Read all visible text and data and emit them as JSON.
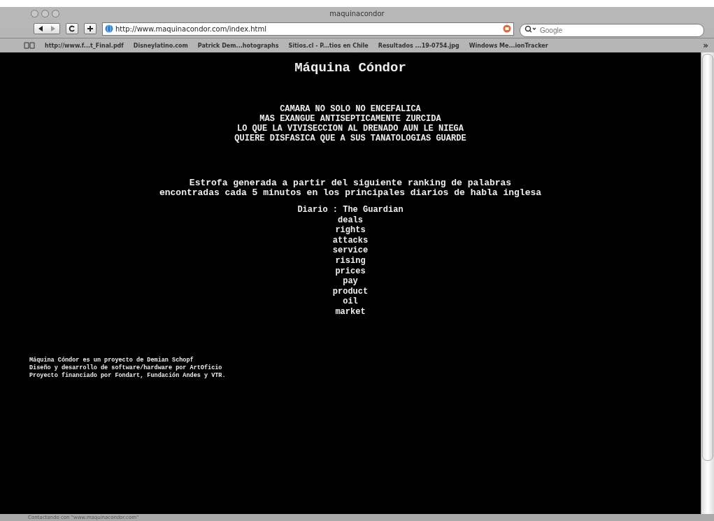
{
  "window": {
    "title": "maquinacondor"
  },
  "toolbar": {
    "url": "http://www.maquinacondor.com/index.html",
    "search_placeholder": "Google"
  },
  "bookmarks": [
    "http://www.f...t_Final.pdf",
    "Disneylatino.com",
    "Patrick Dem...hotographs",
    "Sitios.cl - P...tios en Chile",
    "Resultados ...19-0754.jpg",
    "Windows Me...ionTracker"
  ],
  "bookmarks_more": "»",
  "page": {
    "heading": "Máquina Cóndor",
    "verse": [
      "CAMARA NO SOLO NO ENCEFALICA",
      "MAS EXANGUE ANTISEPTICAMENTE ZURCIDA",
      "LO QUE LA VIVISECCION AL DRENADO AUN LE NIEGA",
      "QUIERE DISFASICA QUE A SUS TANATOLOGIAS GUARDE"
    ],
    "explanation": [
      "Estrofa generada a partir del siguiente ranking de palabras",
      "encontradas cada 5 minutos en los principales diarios de habla inglesa"
    ],
    "newspaper": "Diario : The Guardian",
    "words": [
      "deals",
      "rights",
      "attacks",
      "service",
      "rising",
      "prices",
      "pay",
      "product",
      "oil",
      "market"
    ],
    "credits": [
      "Máquina Cóndor es un proyecto de Demian Schopf",
      "Diseño y desarrollo de software/hardware por ArtOficio",
      "Proyecto financiado por Fondart, Fundación Andes y VTR."
    ]
  },
  "status_bar": "Contactando con \"www.maquinacondor.com\""
}
